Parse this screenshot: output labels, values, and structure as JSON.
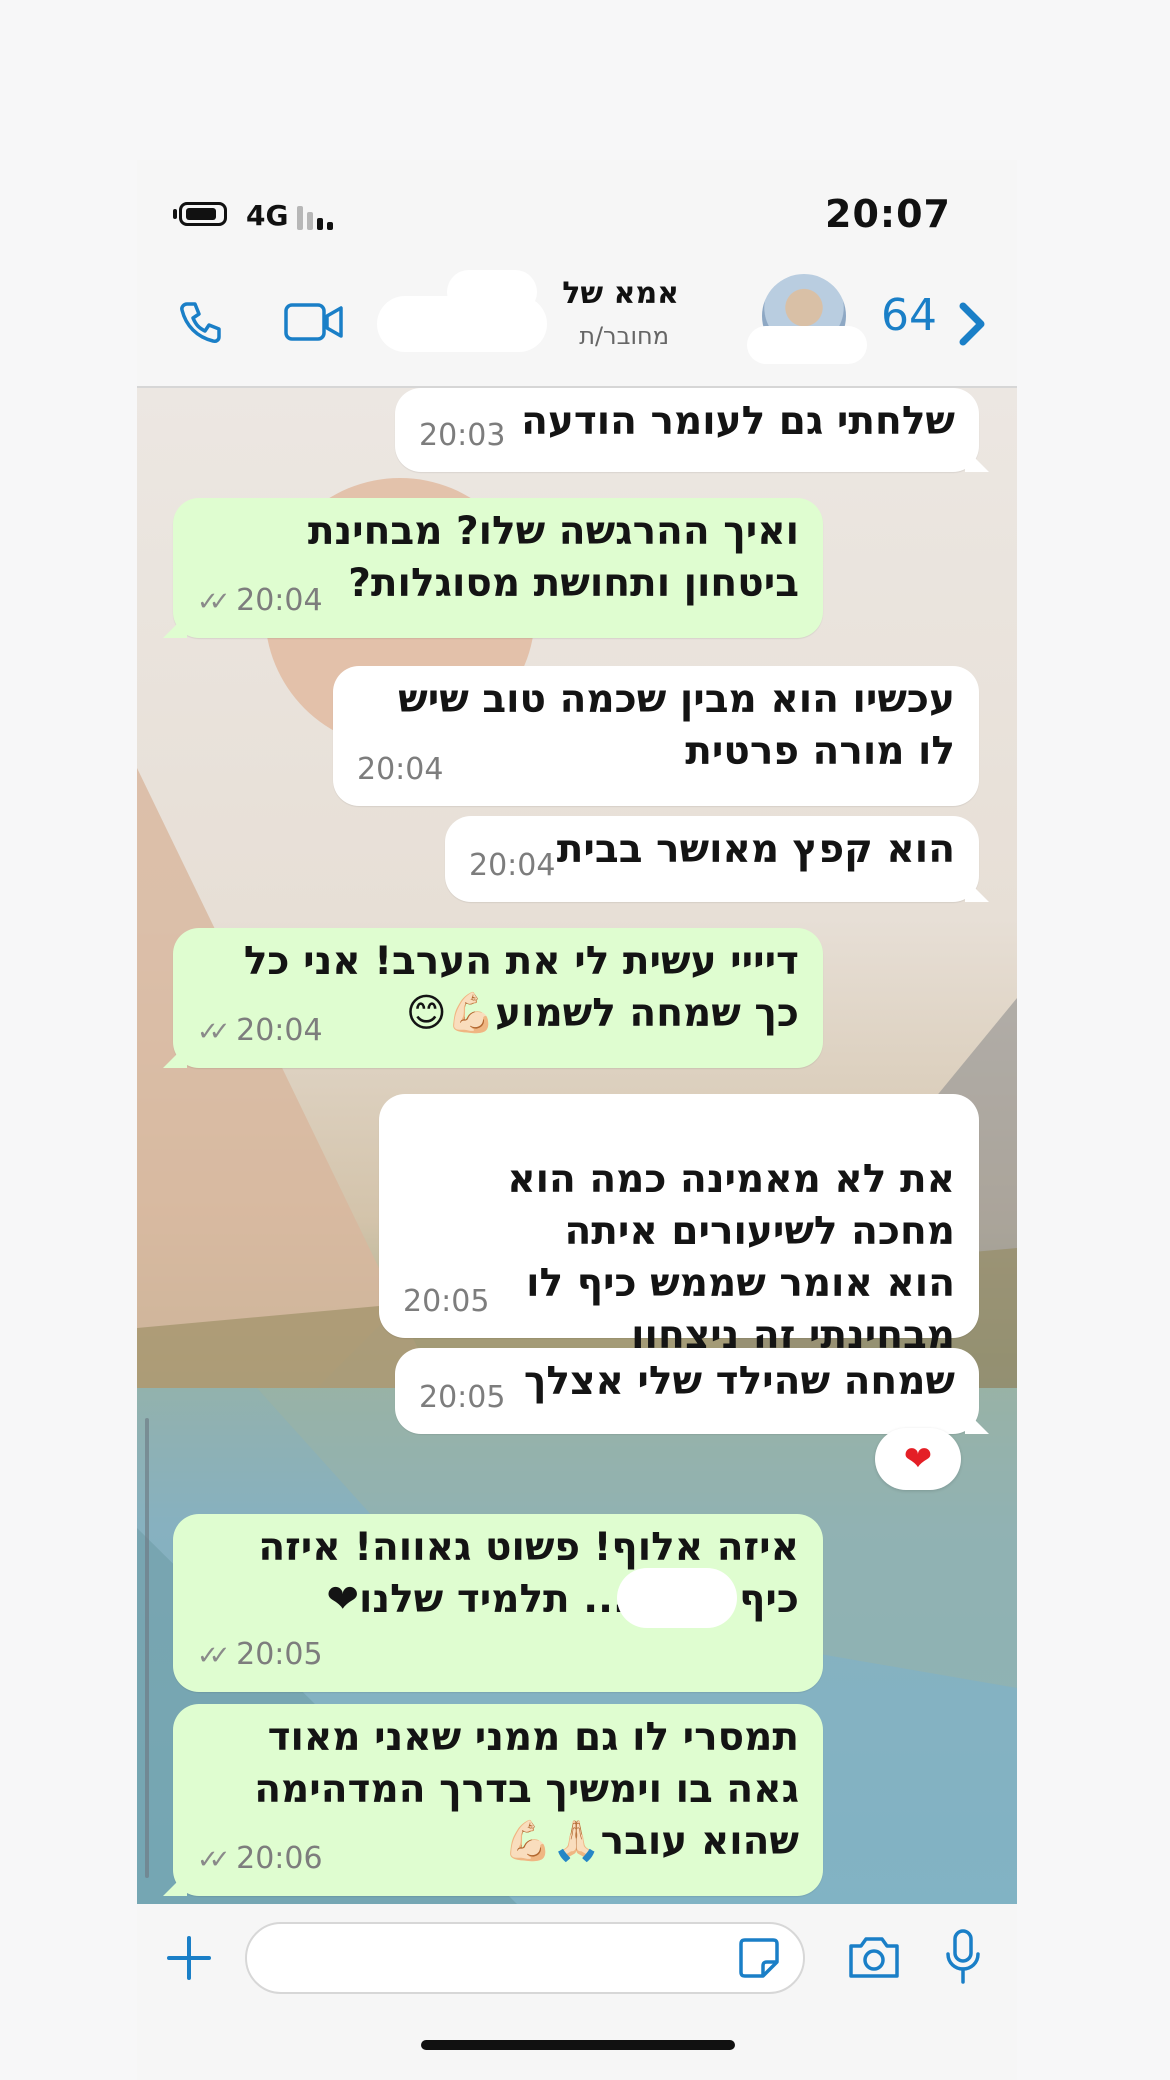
{
  "status_bar": {
    "network": "4G",
    "time": "20:07"
  },
  "header": {
    "back_count": "64",
    "contact_name": "אמא של",
    "contact_status": "מחובר/ת",
    "icons": [
      "chevron-left-icon",
      "avatar",
      "video-icon",
      "phone-icon"
    ]
  },
  "messages": [
    {
      "dir": "in",
      "text": "שלחתי גם לעומר הודעה",
      "time": "20:03"
    },
    {
      "dir": "out",
      "text": "ואיך ההרגשה שלו? מבחינת ביטחון ותחושת מסוגלות?",
      "time": "20:04"
    },
    {
      "dir": "in",
      "text": "עכשיו הוא מבין שכמה טוב שיש לו מורה פרטית",
      "time": "20:04"
    },
    {
      "dir": "in",
      "text": "הוא קפץ מאושר בבית",
      "time": "20:04"
    },
    {
      "dir": "out",
      "text": "דיייי עשית לי את הערב! אני כל כך שמחה לשמוע💪🏻😊",
      "time": "20:04"
    },
    {
      "dir": "in",
      "text": "את לא מאמינה כמה הוא מחכה לשיעורים איתה\nהוא אומר שממש כיף לו\nמבחינתי זה ניצחון",
      "time": "20:05"
    },
    {
      "dir": "in",
      "text": "שמחה שהילד שלי אצלך",
      "time": "20:05",
      "reaction": "❤"
    },
    {
      "dir": "out",
      "text": "איזה אלוף! פשוט גאווה! איזה כיף לנו ש... תלמיד שלנו❤",
      "time": "20:05"
    },
    {
      "dir": "out",
      "text": "תמסרי לו גם ממני שאני מאוד גאה בו וימשיך בדרך המדהימה שהוא עובר🙏🏻💪🏻",
      "time": "20:06"
    }
  ],
  "input_bar": {
    "placeholder": "",
    "icons": [
      "plus-icon",
      "sticker-icon",
      "camera-icon",
      "microphone-icon"
    ]
  },
  "colors": {
    "accent": "#1a7fc7",
    "outgoing_bubble": "#dffdd0",
    "incoming_bubble": "#ffffff"
  }
}
